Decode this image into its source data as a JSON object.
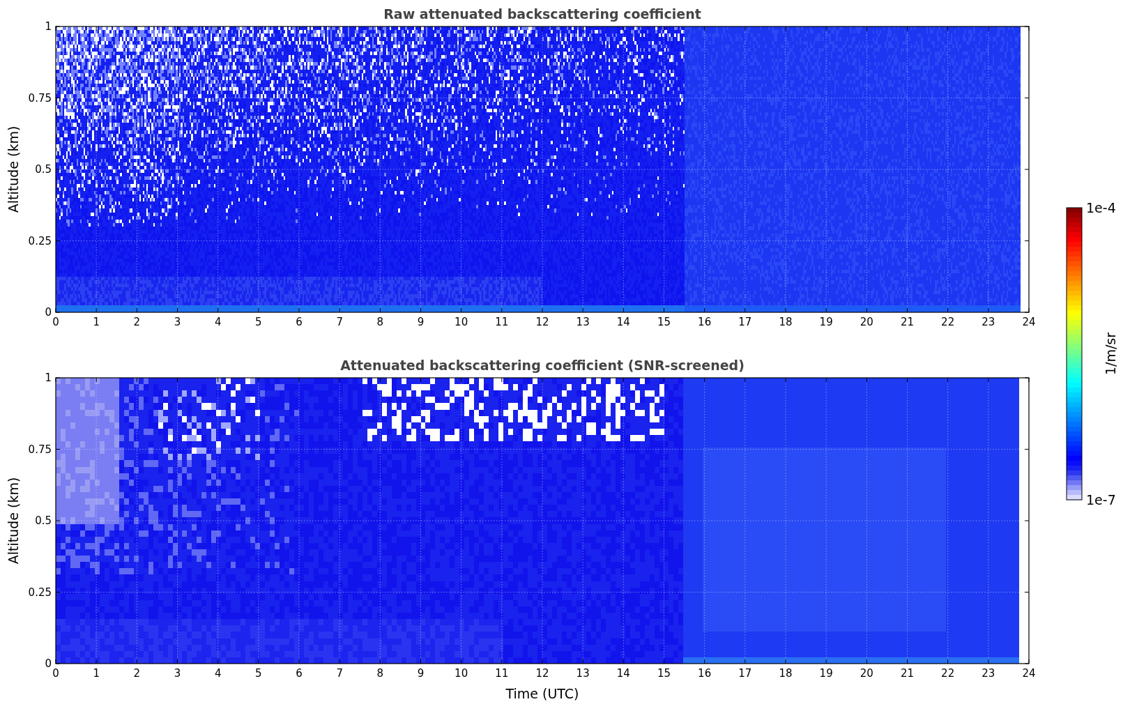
{
  "panels": [
    {
      "kind": "raw",
      "title": "Raw attenuated backscattering coefficient",
      "ylabel": "Altitude (km)",
      "yticks": [
        "1",
        "0.75",
        "0.5",
        "0.25",
        "0"
      ],
      "xticks": [
        "0",
        "1",
        "2",
        "3",
        "4",
        "5",
        "6",
        "7",
        "8",
        "9",
        "10",
        "11",
        "12",
        "13",
        "14",
        "15",
        "16",
        "17",
        "18",
        "19",
        "20",
        "21",
        "22",
        "23",
        "24"
      ]
    },
    {
      "kind": "screened",
      "title": "Attenuated backscattering coefficient (SNR-screened)",
      "ylabel": "Altitude (km)",
      "yticks": [
        "1",
        "0.75",
        "0.5",
        "0.25",
        "0"
      ],
      "xticks": [
        "0",
        "1",
        "2",
        "3",
        "4",
        "5",
        "6",
        "7",
        "8",
        "9",
        "10",
        "11",
        "12",
        "13",
        "14",
        "15",
        "16",
        "17",
        "18",
        "19",
        "20",
        "21",
        "22",
        "23",
        "24"
      ],
      "xlabel": "Time (UTC)"
    }
  ],
  "colorbar": {
    "max": "1e-4",
    "min": "1e-7",
    "label": "1/m/sr"
  }
}
